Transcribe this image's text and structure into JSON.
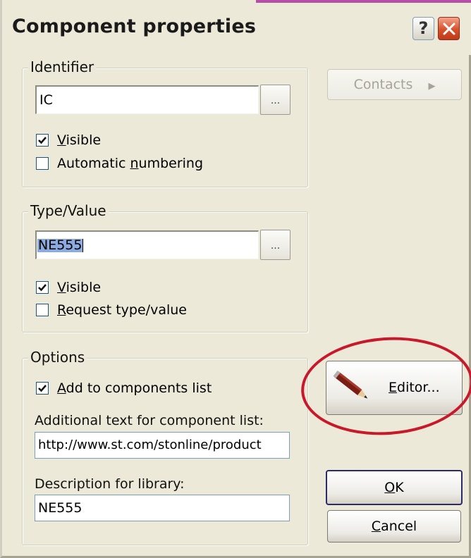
{
  "window": {
    "title": "Component properties",
    "help_symbol": "?",
    "close_symbol": "×"
  },
  "identifier": {
    "legend": "Identifier",
    "value": "IC",
    "browse_label": "...",
    "visible_checked": true,
    "visible_pre": "",
    "visible_mnemonic": "V",
    "visible_post": "isible",
    "auto_checked": false,
    "auto_pre": "Automatic ",
    "auto_mnemonic": "n",
    "auto_post": "umbering"
  },
  "type_value": {
    "legend": "Type/Value",
    "value": "NE555",
    "browse_label": "...",
    "visible_checked": true,
    "visible_pre": "",
    "visible_mnemonic": "V",
    "visible_post": "isible",
    "request_checked": false,
    "request_pre": "",
    "request_mnemonic": "R",
    "request_post": "equest type/value"
  },
  "options": {
    "legend": "Options",
    "add_checked": true,
    "add_pre": "",
    "add_mnemonic": "A",
    "add_post": "dd to components list",
    "additional_label": "Additional text for component list:",
    "additional_value": "http://www.st.com/stonline/product",
    "description_label": "Description for library:",
    "description_value": "NE555"
  },
  "buttons": {
    "contacts_label": "Contacts",
    "contacts_arrow": "▶",
    "editor_pre": "",
    "editor_mnemonic": "E",
    "editor_post": "ditor...",
    "ok_pre": "",
    "ok_mnemonic": "O",
    "ok_post": "K",
    "cancel_pre": "",
    "cancel_mnemonic": "C",
    "cancel_post": "ancel"
  },
  "colors": {
    "dialog_bg": "#ece9d8",
    "highlight_circle": "#c8182a",
    "selection": "#8aaae0"
  }
}
